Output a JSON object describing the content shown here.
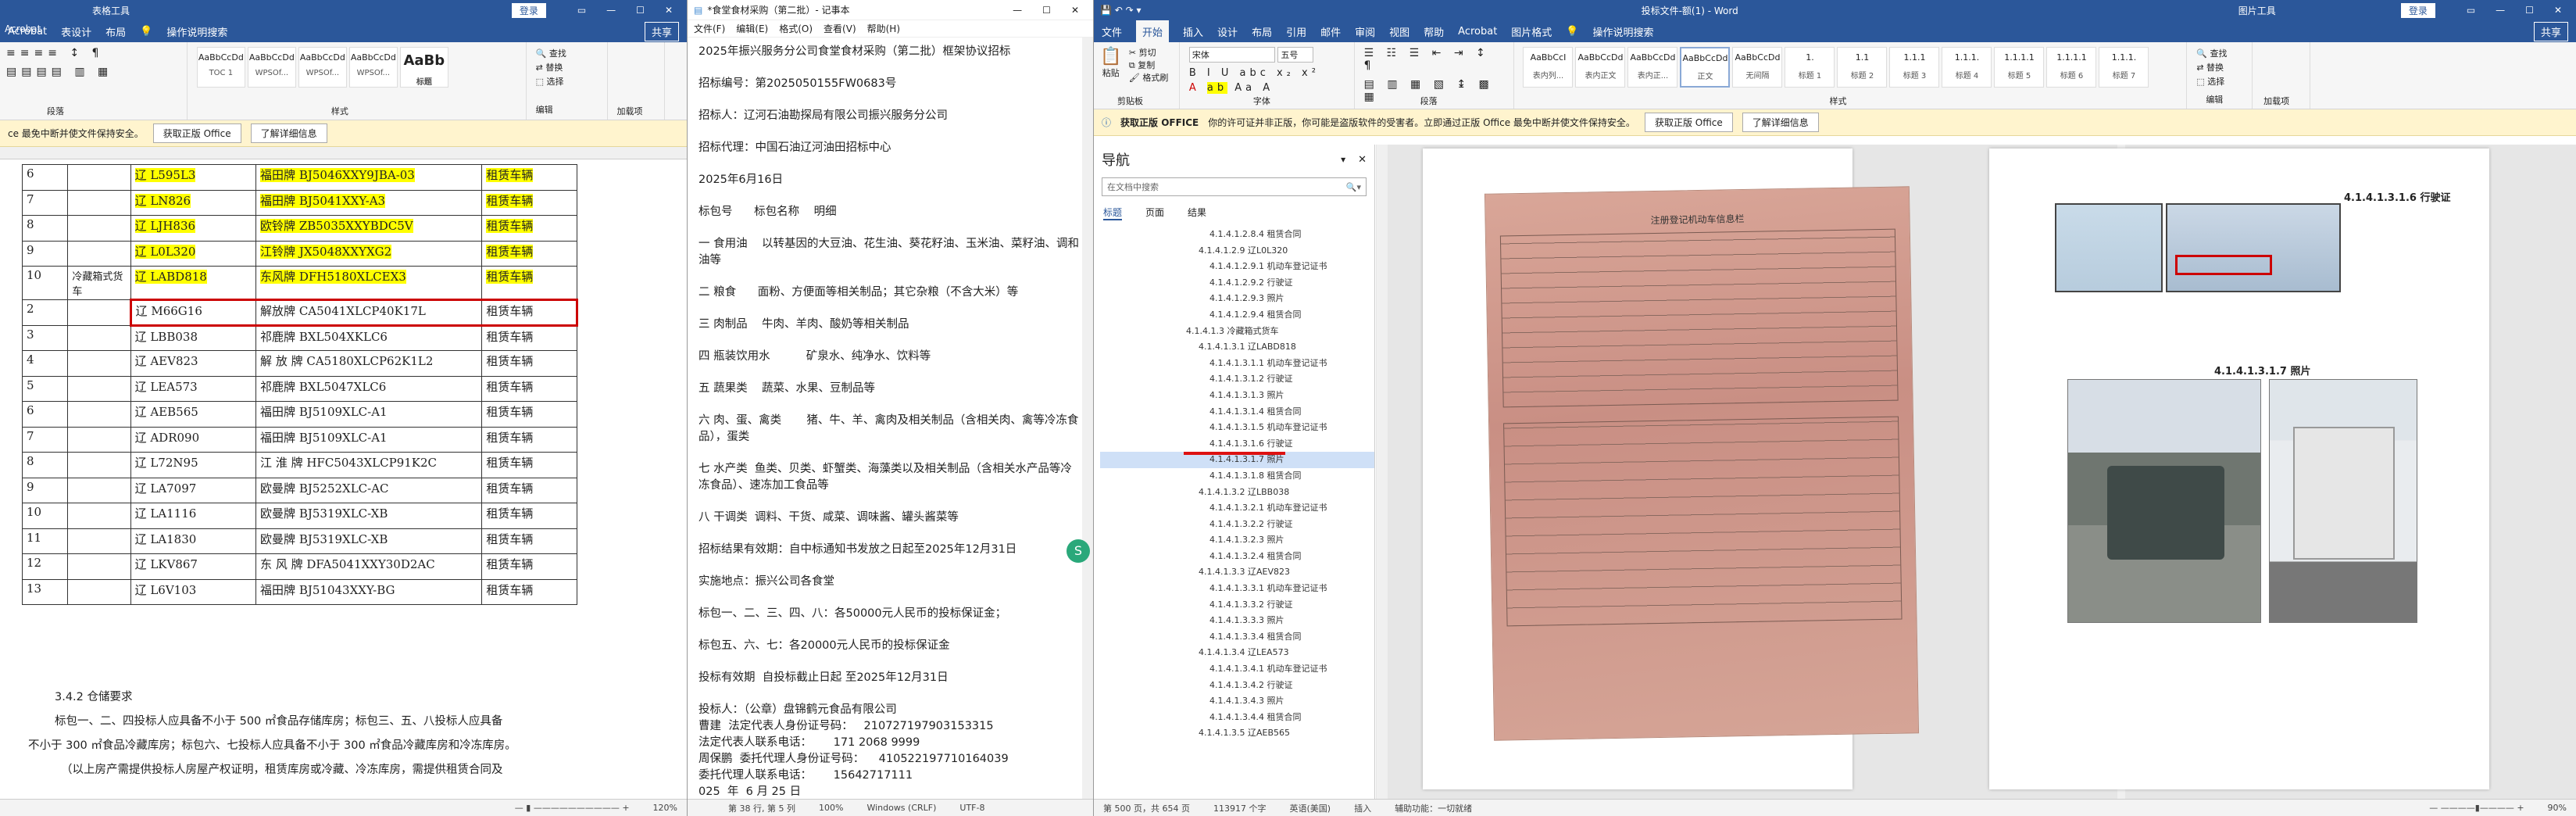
{
  "w1": {
    "title_left": "表格工具",
    "title": "登录",
    "share": "共享",
    "tabs": [
      "Acrobat",
      "表设计",
      "布局"
    ],
    "search": "操作说明搜索",
    "styles": [
      {
        "s": "AaBbCcDd",
        "n": "TOC 1"
      },
      {
        "s": "AaBbCcDd",
        "n": "WPSOf..."
      },
      {
        "s": "AaBbCcDd",
        "n": "WPSOf..."
      },
      {
        "s": "AaBbCcDd",
        "n": "WPSOf..."
      },
      {
        "s": "AaBb",
        "n": "标题"
      }
    ],
    "find": "查找",
    "replace": "替换",
    "select": "选择",
    "group_para": "段落",
    "group_styles": "样式",
    "group_edit": "编辑",
    "group_addin": "加载项",
    "msg": "ce 最免中断并使文件保持安全。",
    "msg_btn1": "获取正版 Office",
    "msg_btn2": "了解详细信息",
    "rows": [
      {
        "n": "6",
        "c": "",
        "plate": "辽 L595L3",
        "model": "福田牌 BJ5046XXY9JBA-03",
        "use": "租赁车辆",
        "hl": true
      },
      {
        "n": "7",
        "c": "",
        "plate": "辽 LN826",
        "model": "福田牌 BJ5041XXY-A3",
        "use": "租赁车辆",
        "hl": true
      },
      {
        "n": "8",
        "c": "",
        "plate": "辽 LJH836",
        "model": "欧铃牌 ZB5035XXYBDC5V",
        "use": "租赁车辆",
        "hl": true
      },
      {
        "n": "9",
        "c": "",
        "plate": "辽 L0L320",
        "model": "江铃牌 JX5048XXYXG2",
        "use": "租赁车辆",
        "hl": true
      },
      {
        "n": "10",
        "c": "冷藏箱式货车",
        "plate": "辽 LABD818",
        "model": "东风牌 DFH5180XLCEX3",
        "use": "租赁车辆",
        "hl": true
      },
      {
        "n": "2",
        "c": "",
        "plate": "辽 M66G16",
        "model": "解放牌 CA5041XLCP40K17L",
        "use": "租赁车辆",
        "hl": false
      },
      {
        "n": "3",
        "c": "",
        "plate": "辽 LBB038",
        "model": "祁鹿牌 BXL504XKLC6",
        "use": "租赁车辆",
        "hl": false
      },
      {
        "n": "4",
        "c": "",
        "plate": "辽 AEV823",
        "model": "解 放 牌 CA5180XLCP62K1L2",
        "use": "租赁车辆",
        "hl": false
      },
      {
        "n": "5",
        "c": "",
        "plate": "辽 LEA573",
        "model": "祁鹿牌 BXL5047XLC6",
        "use": "租赁车辆",
        "hl": false
      },
      {
        "n": "6",
        "c": "",
        "plate": "辽 AEB565",
        "model": "福田牌 BJ5109XLC-A1",
        "use": "租赁车辆",
        "hl": false
      },
      {
        "n": "7",
        "c": "",
        "plate": "辽 ADR090",
        "model": "福田牌 BJ5109XLC-A1",
        "use": "租赁车辆",
        "hl": false
      },
      {
        "n": "8",
        "c": "",
        "plate": "辽 L72N95",
        "model": "江 淮 牌 HFC5043XLCP91K2C",
        "use": "租赁车辆",
        "hl": false
      },
      {
        "n": "9",
        "c": "",
        "plate": "辽 LA7097",
        "model": "欧曼牌 BJ5252XLC-AC",
        "use": "租赁车辆",
        "hl": false
      },
      {
        "n": "10",
        "c": "",
        "plate": "辽 LA1116",
        "model": "欧曼牌 BJ5319XLC-XB",
        "use": "租赁车辆",
        "hl": false
      },
      {
        "n": "11",
        "c": "",
        "plate": "辽 LA1830",
        "model": "欧曼牌 BJ5319XLC-XB",
        "use": "租赁车辆",
        "hl": false
      },
      {
        "n": "12",
        "c": "",
        "plate": "辽 LKV867",
        "model": "东 风 牌 DFA5041XXY30D2AC",
        "use": "租赁车辆",
        "hl": false
      },
      {
        "n": "13",
        "c": "",
        "plate": "辽 L6V103",
        "model": "福田牌 BJ51043XXY-BG",
        "use": "租赁车辆",
        "hl": false
      }
    ],
    "sec_title": "3.4.2 仓储要求",
    "para1": "标包一、二、四投标人应具备不小于 500 ㎡食品存储库房；标包三、五、八投标人应具备",
    "para2": "不小于 300 ㎡食品冷藏库房；标包六、七投标人应具备不小于 300 ㎡食品冷藏库房和冷冻库房。",
    "para3": "（以上房产需提供投标人房屋产权证明，租赁库房或冷藏、冷冻库房，需提供租赁合同及",
    "status_zoom": "120%"
  },
  "w2": {
    "title": "*食堂食材采购（第二批）- 记事本",
    "menu": [
      "文件(F)",
      "编辑(E)",
      "格式(O)",
      "查看(V)",
      "帮助(H)"
    ],
    "lines": [
      "2025年振兴服务分公司食堂食材采购（第二批）框架协议招标",
      "招标编号：第2025050155FW0683号",
      "招标人：辽河石油勘探局有限公司振兴服务分公司",
      "招标代理：中国石油辽河油田招标中心",
      "2025年6月16日",
      "标包号      标包名称    明细",
      "一 食用油    以转基因的大豆油、花生油、葵花籽油、玉米油、菜籽油、调和油等",
      "二 粮食      面粉、方便面等相关制品；其它杂粮（不含大米）等",
      "三 肉制品    牛肉、羊肉、酸奶等相关制品",
      "四 瓶装饮用水          矿泉水、纯净水、饮料等",
      "五 蔬果类    蔬菜、水果、豆制品等",
      "六 肉、蛋、禽类       猪、牛、羊、禽肉及相关制品（含相关肉、禽等冷冻食品），蛋类",
      "七 水产类  鱼类、贝类、虾蟹类、海藻类以及相关制品（含相关水产品等冷冻食品）、速冻加工食品等",
      "八 干调类  调料、干货、咸菜、调味酱、罐头酱菜等",
      "招标结果有效期：自中标通知书发放之日起至2025年12月31日",
      "实施地点：振兴公司各食堂",
      "标包一、二、三、四、八：各50000元人民币的投标保证金；",
      "标包五、六、七：各20000元人民币的投标保证金",
      "投标有效期  自投标截止日起 至2025年12月31日",
      "投标人：（公章）盘锦鹤元食品有限公司",
      "曹建  法定代表人身份证号码：   210727197903153315",
      "法定代表人联系电话：      171 2068 9999",
      "周保鹏  委托代理人身份证号码：    410522197710164039",
      "委托代理人联系电话：      15642717111",
      "025  年  6 月 25 日"
    ],
    "status": [
      "第 38 行, 第 5 列",
      "100%",
      "Windows (CRLF)",
      "UTF-8"
    ]
  },
  "w3": {
    "title": "投标文件-额(1) - Word",
    "login": "登录",
    "title_right": "图片工具",
    "tabs": [
      "文件",
      "开始",
      "插入",
      "设计",
      "布局",
      "引用",
      "邮件",
      "审阅",
      "视图",
      "帮助",
      "Acrobat",
      "图片格式"
    ],
    "search": "操作说明搜索",
    "share": "共享",
    "font": "宋体",
    "size": "五号",
    "clip": "剪贴板",
    "font_grp": "字体",
    "para": "段落",
    "styles_grp": "样式",
    "edit": "编辑",
    "addin": "加载项",
    "paste": "粘贴",
    "cut": "剪切",
    "copy": "复制",
    "fmt": "格式刷",
    "styles": [
      {
        "s": "AaBbCcI",
        "n": "表内列..."
      },
      {
        "s": "AaBbCcDd",
        "n": "表内正文"
      },
      {
        "s": "AaBbCcDd",
        "n": "表内正..."
      },
      {
        "s": "AaBbCcDd",
        "n": "正文"
      },
      {
        "s": "AaBbCcDd",
        "n": "无间隔"
      },
      {
        "s": "1.",
        "n": "标题 1"
      },
      {
        "s": "1.1",
        "n": "标题 2"
      },
      {
        "s": "1.1.1",
        "n": "标题 3"
      },
      {
        "s": "1.1.1.",
        "n": "标题 4"
      },
      {
        "s": "1.1.1.1",
        "n": "标题 5"
      },
      {
        "s": "1.1.1.1",
        "n": "标题 6"
      },
      {
        "s": "1.1.1.",
        "n": "标题 7"
      }
    ],
    "find": "查找",
    "replace": "替换",
    "select": "选择",
    "msg_label": "获取正版 OFFICE",
    "msg": "你的许可证并非正版，你可能是盗版软件的受害者。立即通过正版 Office 最免中断并使文件保持安全。",
    "msg_btn1": "获取正版 Office",
    "msg_btn2": "了解详细信息",
    "nav_title": "导航",
    "nav_search": "在文档中搜索",
    "nav_tabs": [
      "标题",
      "页面",
      "结果"
    ],
    "nav_items": [
      "4.1.4.1.2.8.4 租赁合同",
      "4.1.4.1.2.9 辽L0L320",
      "4.1.4.1.2.9.1 机动车登记证书",
      "4.1.4.1.2.9.2 行驶证",
      "4.1.4.1.2.9.3 照片",
      "4.1.4.1.2.9.4 租赁合同",
      "4.1.4.1.3 冷藏箱式货车",
      "4.1.4.1.3.1 辽LABD818",
      "4.1.4.1.3.1.1 机动车登记证书",
      "4.1.4.1.3.1.2 行驶证",
      "4.1.4.1.3.1.3 照片",
      "4.1.4.1.3.1.4 租赁合同",
      "4.1.4.1.3.1.5 机动车登记证书",
      "4.1.4.1.3.1.6 行驶证",
      "4.1.4.1.3.1.7 照片",
      "4.1.4.1.3.1.8 租赁合同",
      "4.1.4.1.3.2 辽LBB038",
      "4.1.4.1.3.2.1 机动车登记证书",
      "4.1.4.1.3.2.2 行驶证",
      "4.1.4.1.3.2.3 照片",
      "4.1.4.1.3.2.4 租赁合同",
      "4.1.4.1.3.3 辽AEV823",
      "4.1.4.1.3.3.1 机动车登记证书",
      "4.1.4.1.3.3.2 行驶证",
      "4.1.4.1.3.3.3 照片",
      "4.1.4.1.3.3.4 租赁合同",
      "4.1.4.1.3.4 辽LEA573",
      "4.1.4.1.3.4.1 机动车登记证书",
      "4.1.4.1.3.4.2 行驶证",
      "4.1.4.1.3.4.3 照片",
      "4.1.4.1.3.4.4 租赁合同",
      "4.1.4.1.3.5 辽AEB565"
    ],
    "doc_reg_title": "注册登记机动车信息栏",
    "caption1": "4.1.4.1.3.1.6   行驶证",
    "caption2": "4.1.4.1.3.1.7   照片",
    "status": [
      "第 500 页，共 654 页",
      "113917 个字",
      "英语(美国)",
      "插入",
      "辅助功能：一切就绪"
    ],
    "zoom": "90%"
  }
}
